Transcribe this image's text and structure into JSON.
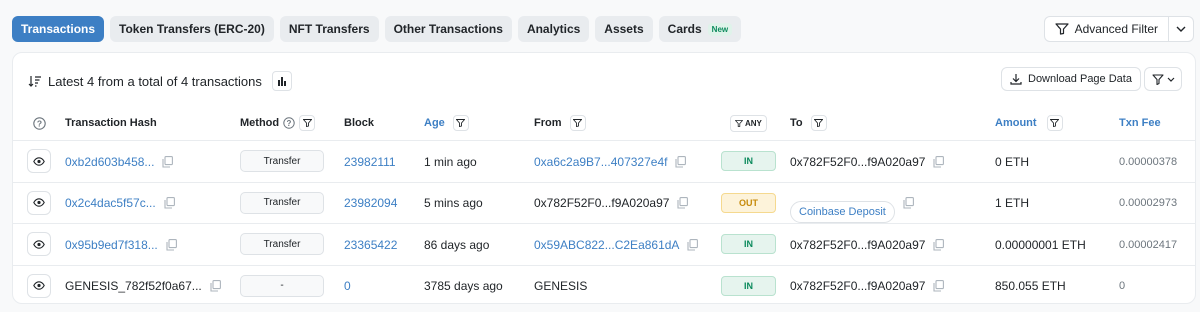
{
  "tabs": [
    {
      "label": "Transactions",
      "active": true
    },
    {
      "label": "Token Transfers (ERC-20)"
    },
    {
      "label": "NFT Transfers"
    },
    {
      "label": "Other Transactions"
    },
    {
      "label": "Analytics"
    },
    {
      "label": "Assets"
    },
    {
      "label": "Cards",
      "badge": "New"
    }
  ],
  "advanced_filter": {
    "label": "Advanced Filter"
  },
  "summary": {
    "text": "Latest 4 from a total of 4 transactions"
  },
  "download": {
    "label": "Download Page Data"
  },
  "columns": {
    "hash": "Transaction Hash",
    "method": "Method",
    "block": "Block",
    "age": "Age",
    "from": "From",
    "any": "ANY",
    "to": "To",
    "amount": "Amount",
    "fee": "Txn Fee"
  },
  "rows": [
    {
      "hash": "0xb2d603b458...",
      "method": "Transfer",
      "block": "23982111",
      "age": "1 min ago",
      "from": "0xa6c2a9B7...407327e4f",
      "from_link": true,
      "dir": "IN",
      "to": "0x782F52F0...f9A020a97",
      "to_badge": false,
      "amount": "0 ETH",
      "fee": "0.00000378"
    },
    {
      "hash": "0x2c4dac5f57c...",
      "method": "Transfer",
      "block": "23982094",
      "age": "5 mins ago",
      "from": "0x782F52F0...f9A020a97",
      "from_link": false,
      "dir": "OUT",
      "to": "Coinbase Deposit",
      "to_badge": true,
      "amount": "1 ETH",
      "fee": "0.00002973"
    },
    {
      "hash": "0x95b9ed7f318...",
      "method": "Transfer",
      "block": "23365422",
      "age": "86 days ago",
      "from": "0x59ABC822...C2Ea861dA",
      "from_link": true,
      "dir": "IN",
      "to": "0x782F52F0...f9A020a97",
      "to_badge": false,
      "amount": "0.00000001 ETH",
      "fee": "0.00002417"
    },
    {
      "hash": "GENESIS_782f52f0a67...",
      "method": "-",
      "block": "0",
      "age": "3785 days ago",
      "from": "GENESIS",
      "from_link": false,
      "dir": "IN",
      "to": "0x782F52F0...f9A020a97",
      "to_badge": false,
      "amount": "850.055 ETH",
      "fee": "0"
    }
  ],
  "colors": {
    "accent": "#3d7fc4",
    "in": "#0b8a5c",
    "out": "#c68a0a"
  }
}
